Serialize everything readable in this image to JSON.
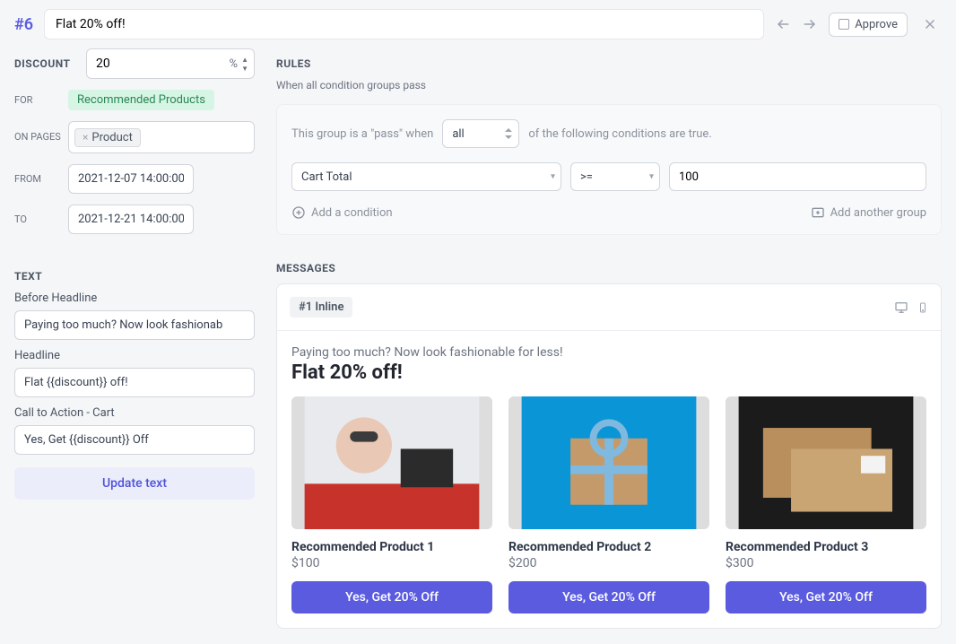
{
  "header": {
    "page_id_label": "#6",
    "title": "Flat 20% off!",
    "approve_label": "Approve"
  },
  "left": {
    "discount": {
      "label": "DISCOUNT",
      "value": "20",
      "unit": "%"
    },
    "for": {
      "label": "FOR",
      "tag": "Recommended Products"
    },
    "on_pages": {
      "label": "ON PAGES",
      "chip": "Product"
    },
    "from": {
      "label": "FROM",
      "value": "2021-12-07 14:00:00"
    },
    "to": {
      "label": "TO",
      "value": "2021-12-21 14:00:00"
    },
    "text_section": "TEXT",
    "before_headline": {
      "label": "Before Headline",
      "value": "Paying too much? Now look fashionab"
    },
    "headline": {
      "label": "Headline",
      "value": "Flat {{discount}} off!"
    },
    "cta": {
      "label": "Call to Action - Cart",
      "value": "Yes, Get {{discount}} Off"
    },
    "update_btn": "Update text"
  },
  "rules": {
    "heading": "RULES",
    "subtitle": "When all condition groups pass",
    "group_prefix": "This group is a \"pass\" when",
    "group_mode": "all",
    "group_suffix": "of the following conditions are true.",
    "condition": {
      "field": "Cart Total",
      "operator": ">=",
      "value": "100"
    },
    "add_condition": "Add a condition",
    "add_group": "Add another group"
  },
  "messages": {
    "heading": "MESSAGES",
    "badge": "#1 Inline",
    "preview": {
      "before_headline": "Paying too much? Now look fashionable for less!",
      "headline": "Flat 20% off!",
      "products": [
        {
          "title": "Recommended Product 1",
          "price": "$100",
          "cta": "Yes, Get 20% Off"
        },
        {
          "title": "Recommended Product 2",
          "price": "$200",
          "cta": "Yes, Get 20% Off"
        },
        {
          "title": "Recommended Product 3",
          "price": "$300",
          "cta": "Yes, Get 20% Off"
        }
      ]
    }
  }
}
